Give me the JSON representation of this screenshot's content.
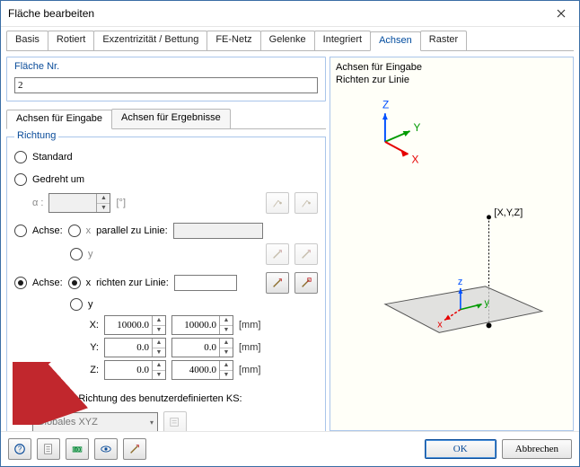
{
  "window": {
    "title": "Fläche bearbeiten"
  },
  "tabs": [
    "Basis",
    "Rotiert",
    "Exzentrizität / Bettung",
    "FE-Netz",
    "Gelenke",
    "Integriert",
    "Achsen",
    "Raster"
  ],
  "tabs_active": 6,
  "surface_no": {
    "label": "Fläche Nr.",
    "value": "2"
  },
  "subtabs": {
    "input": "Achsen für Eingabe",
    "results": "Achsen für Ergebnisse",
    "active": 0
  },
  "direction": {
    "title": "Richtung",
    "r_standard": "Standard",
    "r_rotated": "Gedreht um",
    "alpha_label": "α :",
    "alpha_unit": "[°]",
    "alpha_value": "",
    "r_axis_parallel": "Achse:",
    "parallel_text": "parallel zu Linie:",
    "parallel_value": "",
    "r_axis_to": "Achse:",
    "to_text": "richten zur Linie:",
    "to_value": "",
    "axis_x": "x",
    "axis_y": "y",
    "coords": {
      "X": {
        "label": "X:",
        "a": "10000.0",
        "b": "10000.0"
      },
      "Y": {
        "label": "Y:",
        "a": "0.0",
        "b": "0.0"
      },
      "Z": {
        "label": "Z:",
        "a": "0.0",
        "b": "4000.0"
      }
    },
    "unit": "[mm]",
    "r_userks": "Achsen in Richtung des benutzerdefinierten KS:",
    "ks_value": "Globales XYZ"
  },
  "preview": {
    "line1": "Achsen für Eingabe",
    "line2": "Richten zur Linie",
    "point_label": "[X,Y,Z]",
    "axis_big": {
      "x": "X",
      "y": "Y",
      "z": "Z"
    },
    "axis_small": {
      "x": "x",
      "y": "y",
      "z": "z"
    }
  },
  "buttons": {
    "ok": "OK",
    "cancel": "Abbrechen"
  }
}
